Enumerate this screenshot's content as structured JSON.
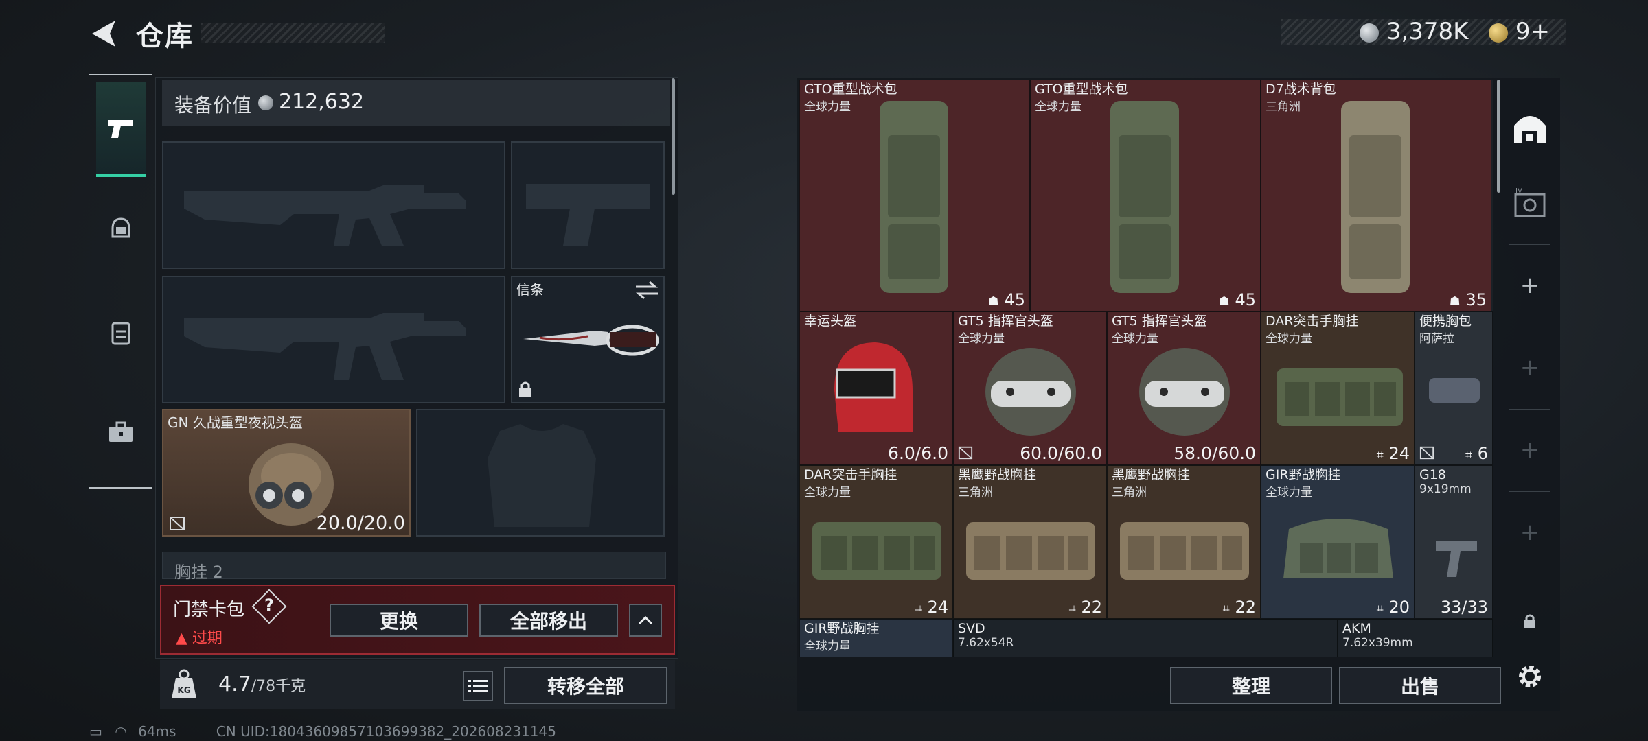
{
  "header": {
    "title": "仓库",
    "currency_main": "3,378K",
    "currency_premium": "9+"
  },
  "categories": [
    "weapons",
    "helmet",
    "backpack",
    "case"
  ],
  "equipment": {
    "value_label": "装备价值",
    "value": "212,632",
    "melee_slot_label": "信条",
    "helmet_name": "GN 久战重型夜视头盔",
    "helmet_durability": "20.0/20.0",
    "chest_label": "胸挂 2"
  },
  "keycard": {
    "label": "门禁卡包",
    "help": "?",
    "status": "过期",
    "replace_label": "更换",
    "remove_all_label": "全部移出"
  },
  "weight": {
    "current": "4.7",
    "max": "/78千克",
    "transfer_all_label": "转移全部"
  },
  "status": {
    "ping": "64ms",
    "uid": "CN UID:18043609857103699382_202608231145"
  },
  "storage": {
    "items": [
      {
        "name": "GTO重型战术包",
        "sub": "全球力量",
        "value": "45"
      },
      {
        "name": "GTO重型战术包",
        "sub": "全球力量",
        "value": "45"
      },
      {
        "name": "D7战术背包",
        "sub": "三角洲",
        "value": "35"
      },
      {
        "name": "幸运头盔",
        "sub": "",
        "value": "6.0/6.0"
      },
      {
        "name": "GT5 指挥官头盔",
        "sub": "全球力量",
        "value": "60.0/60.0"
      },
      {
        "name": "GT5 指挥官头盔",
        "sub": "全球力量",
        "value": "58.0/60.0"
      },
      {
        "name": "DAR突击手胸挂",
        "sub": "全球力量",
        "value": "24"
      },
      {
        "name": "便携胸包",
        "sub": "阿萨拉",
        "value": "6"
      },
      {
        "name": "DAR突击手胸挂",
        "sub": "全球力量",
        "value": "24"
      },
      {
        "name": "黑鹰野战胸挂",
        "sub": "三角洲",
        "value": "22"
      },
      {
        "name": "黑鹰野战胸挂",
        "sub": "三角洲",
        "value": "22"
      },
      {
        "name": "GIR野战胸挂",
        "sub": "全球力量",
        "value": "20"
      },
      {
        "name": "G18",
        "sub": "9x19mm",
        "value": "33/33"
      },
      {
        "name": "GIR野战胸挂",
        "sub": "全球力量",
        "value": ""
      },
      {
        "name": "SVD",
        "sub": "7.62x54R",
        "value": ""
      },
      {
        "name": "AKM",
        "sub": "7.62x39mm",
        "value": ""
      }
    ],
    "sort_label": "整理",
    "sell_label": "出售"
  },
  "colors": {
    "accent_green": "#35d0a5",
    "expired_red": "#ff4a4a",
    "rare_red_bg": "#4d2528"
  }
}
